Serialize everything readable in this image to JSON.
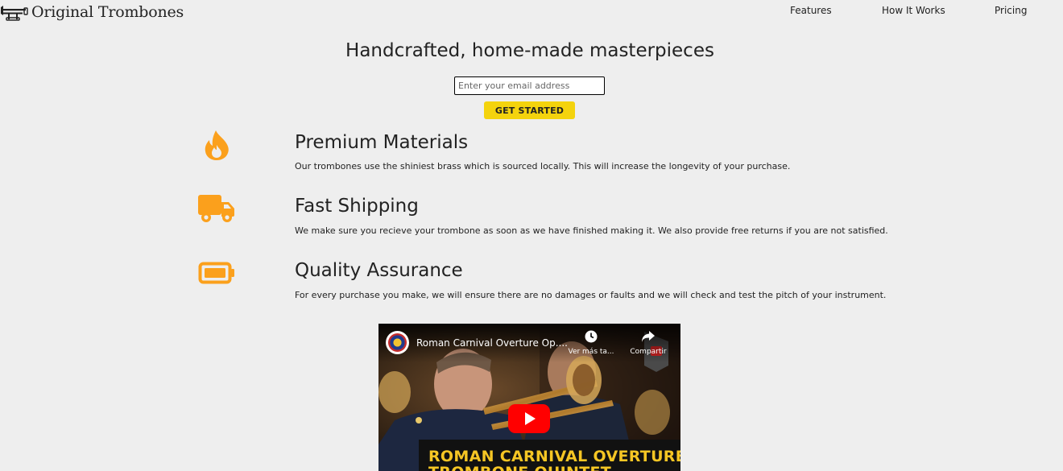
{
  "header": {
    "brand": "Original Trombones",
    "logo_icon": "trombone-logo-icon",
    "nav": [
      {
        "label": "Features"
      },
      {
        "label": "How It Works"
      },
      {
        "label": "Pricing"
      }
    ]
  },
  "hero": {
    "title": "Handcrafted, home-made masterpieces",
    "email_placeholder": "Enter your email address",
    "cta_label": "GET STARTED"
  },
  "colors": {
    "accent_orange": "#fba01c",
    "button_yellow": "#f4d30d",
    "background": "#eeeeee"
  },
  "features": [
    {
      "icon": "fire-icon",
      "title": "Premium Materials",
      "description": "Our trombones use the shiniest brass which is sourced locally. This will increase the longevity of your purchase."
    },
    {
      "icon": "truck-icon",
      "title": "Fast Shipping",
      "description": "We make sure you recieve your trombone as soon as we have finished making it. We also provide free returns if you are not satisfied."
    },
    {
      "icon": "battery-icon",
      "title": "Quality Assurance",
      "description": "For every purchase you make, we will ensure there are no damages or faults and we will check and test the pitch of your instrument."
    }
  ],
  "video": {
    "title": "Roman Carnival Overture Op....",
    "watch_later_label": "Ver más ta...",
    "share_label": "Compartir",
    "banner_line1": "ROMAN CARNIVAL OVERTURE",
    "banner_line2": "TROMBONE QUINTET"
  }
}
